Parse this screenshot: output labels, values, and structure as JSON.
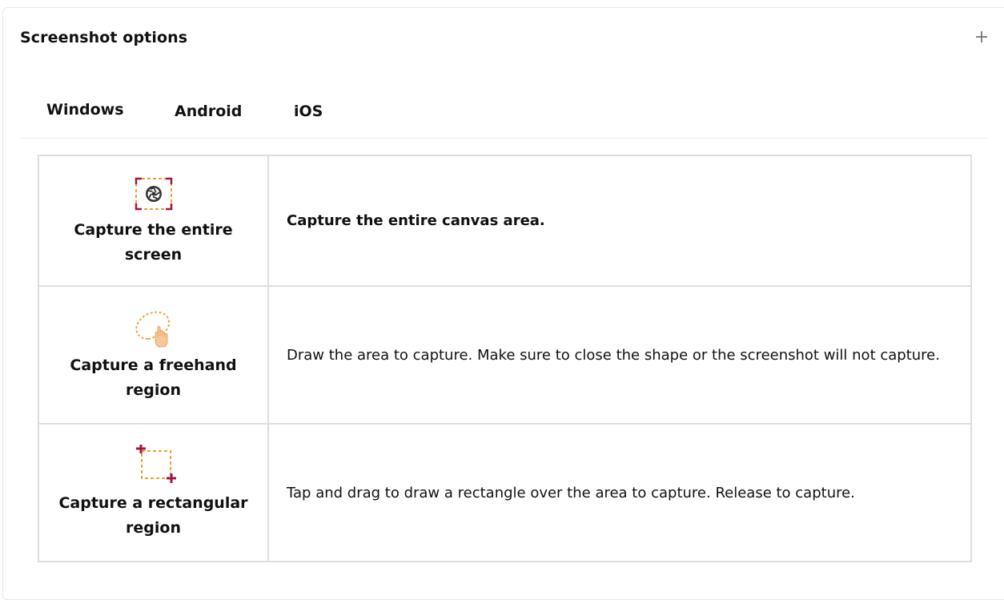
{
  "panel": {
    "title": "Screenshot options",
    "expand_icon": "plus-icon"
  },
  "tabs": [
    {
      "label": "Windows",
      "active": true
    },
    {
      "label": "Android",
      "active": false
    },
    {
      "label": "iOS",
      "active": false
    }
  ],
  "options": [
    {
      "icon": "camera-aperture-frame-icon",
      "label": "Capture the entire screen",
      "description": "Capture the entire canvas area.",
      "description_bold": true
    },
    {
      "icon": "freehand-lasso-hand-icon",
      "label": "Capture a freehand region",
      "description": "Draw the area to capture. Make sure to close the shape or the screenshot will not capture.",
      "description_bold": false
    },
    {
      "icon": "rectangle-select-crosshair-icon",
      "label": "Capture a rectangular region",
      "description": "Tap and drag to draw a rectangle over the area to capture. Release to capture.",
      "description_bold": false
    }
  ],
  "colors": {
    "accent_orange": "#f0a030",
    "accent_red": "#a3173a",
    "border": "#dedede"
  }
}
